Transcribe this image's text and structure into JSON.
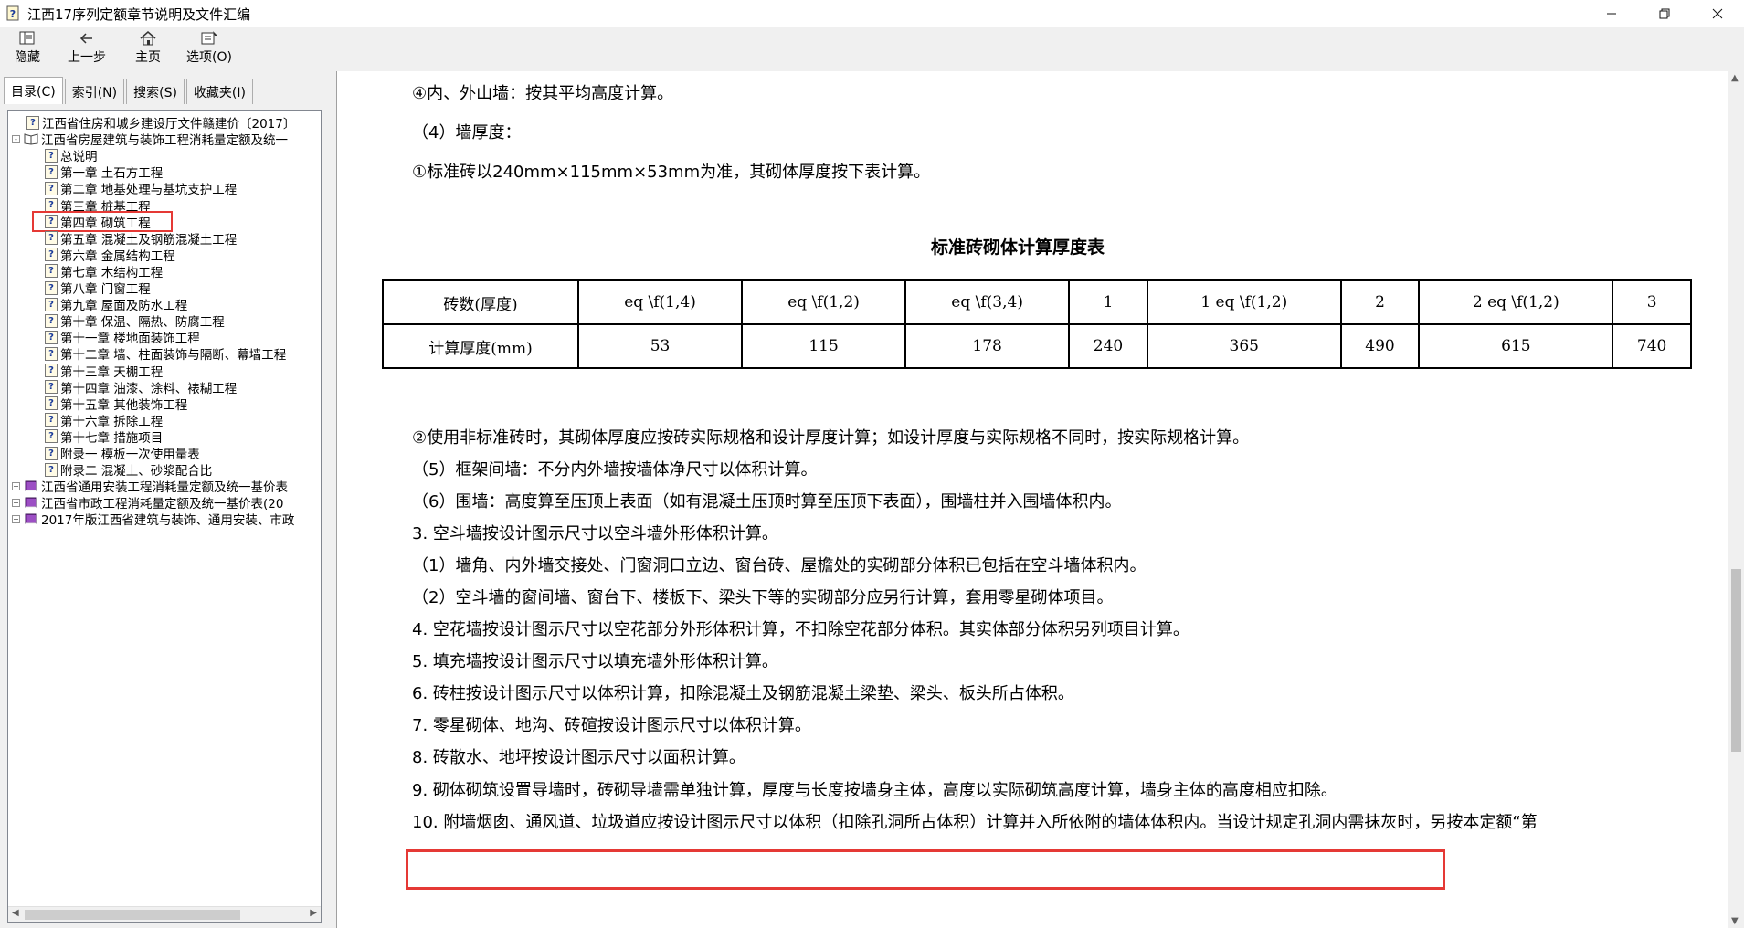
{
  "window": {
    "title": "江西17序列定额章节说明及文件汇编",
    "controls": [
      "minimize",
      "maximize",
      "close"
    ]
  },
  "toolbar": {
    "buttons": [
      {
        "label": "隐藏",
        "icon": "hide-icon"
      },
      {
        "label": "上一步",
        "icon": "back-arrow-icon"
      },
      {
        "label": "主页",
        "icon": "home-icon"
      },
      {
        "label": "选项(O)",
        "icon": "options-icon"
      }
    ]
  },
  "tabs": [
    {
      "label": "目录(C)",
      "active": true
    },
    {
      "label": "索引(N)",
      "active": false
    },
    {
      "label": "搜索(S)",
      "active": false
    },
    {
      "label": "收藏夹(I)",
      "active": false
    }
  ],
  "tree": [
    {
      "label": "江西省住房和城乡建设厅文件赣建价〔2017〕",
      "level": 1,
      "icon": "help-page-icon",
      "expander": ""
    },
    {
      "label": "江西省房屋建筑与装饰工程消耗量定额及统一",
      "level": 0,
      "icon": "open-book-icon",
      "expander": "-"
    },
    {
      "label": "总说明",
      "level": 2,
      "icon": "help-page-icon",
      "expander": ""
    },
    {
      "label": "第一章  土石方工程",
      "level": 2,
      "icon": "help-page-icon",
      "expander": ""
    },
    {
      "label": "第二章  地基处理与基坑支护工程",
      "level": 2,
      "icon": "help-page-icon",
      "expander": ""
    },
    {
      "label": "第三章  桩基工程",
      "level": 2,
      "icon": "help-page-icon",
      "expander": ""
    },
    {
      "label": "第四章  砌筑工程",
      "level": 2,
      "icon": "help-page-icon",
      "expander": "",
      "selected": true
    },
    {
      "label": "第五章  混凝土及钢筋混凝土工程",
      "level": 2,
      "icon": "help-page-icon",
      "expander": ""
    },
    {
      "label": "第六章  金属结构工程",
      "level": 2,
      "icon": "help-page-icon",
      "expander": ""
    },
    {
      "label": "第七章  木结构工程",
      "level": 2,
      "icon": "help-page-icon",
      "expander": ""
    },
    {
      "label": "第八章  门窗工程",
      "level": 2,
      "icon": "help-page-icon",
      "expander": ""
    },
    {
      "label": "第九章  屋面及防水工程",
      "level": 2,
      "icon": "help-page-icon",
      "expander": ""
    },
    {
      "label": "第十章  保温、隔热、防腐工程",
      "level": 2,
      "icon": "help-page-icon",
      "expander": ""
    },
    {
      "label": "第十一章  楼地面装饰工程",
      "level": 2,
      "icon": "help-page-icon",
      "expander": ""
    },
    {
      "label": "第十二章  墙、柱面装饰与隔断、幕墙工程",
      "level": 2,
      "icon": "help-page-icon",
      "expander": ""
    },
    {
      "label": "第十三章  天棚工程",
      "level": 2,
      "icon": "help-page-icon",
      "expander": ""
    },
    {
      "label": "第十四章  油漆、涂料、裱糊工程",
      "level": 2,
      "icon": "help-page-icon",
      "expander": ""
    },
    {
      "label": "第十五章  其他装饰工程",
      "level": 2,
      "icon": "help-page-icon",
      "expander": ""
    },
    {
      "label": "第十六章  拆除工程",
      "level": 2,
      "icon": "help-page-icon",
      "expander": ""
    },
    {
      "label": "第十七章  措施项目",
      "level": 2,
      "icon": "help-page-icon",
      "expander": ""
    },
    {
      "label": "附录一  模板一次使用量表",
      "level": 2,
      "icon": "help-page-icon",
      "expander": ""
    },
    {
      "label": "附录二  混凝土、砂浆配合比",
      "level": 2,
      "icon": "help-page-icon",
      "expander": ""
    },
    {
      "label": "江西省通用安装工程消耗量定额及统一基价表",
      "level": 0,
      "icon": "closed-book-icon",
      "expander": "+"
    },
    {
      "label": "江西省市政工程消耗量定额及统一基价表(20",
      "level": 0,
      "icon": "closed-book-icon",
      "expander": "+"
    },
    {
      "label": "2017年版江西省建筑与装饰、通用安装、市政",
      "level": 0,
      "icon": "closed-book-icon",
      "expander": "+"
    }
  ],
  "content": {
    "lines_top": [
      "④内、外山墙：按其平均高度计算。",
      "（4）墙厚度：",
      "①标准砖以240mm×115mm×53mm为准，其砌体厚度按下表计算。"
    ],
    "table": {
      "title": "标准砖砌体计算厚度表",
      "header": [
        "砖数(厚度)",
        "eq \\f(1,4)",
        "eq \\f(1,2)",
        "eq \\f(3,4)",
        "1",
        "1 eq \\f(1,2)",
        "2",
        "2 eq \\f(1,2)",
        "3"
      ],
      "row": [
        "计算厚度(mm)",
        "53",
        "115",
        "178",
        "240",
        "365",
        "490",
        "615",
        "740"
      ]
    },
    "lines_bottom": [
      "②使用非标准砖时，其砌体厚度应按砖实际规格和设计厚度计算；如设计厚度与实际规格不同时，按实际规格计算。",
      "（5）框架间墙：不分内外墙按墙体净尺寸以体积计算。",
      "（6）围墙：高度算至压顶上表面（如有混凝土压顶时算至压顶下表面），围墙柱并入围墙体积内。",
      "3. 空斗墙按设计图示尺寸以空斗墙外形体积计算。",
      "（1）墙角、内外墙交接处、门窗洞口立边、窗台砖、屋檐处的实砌部分体积已包括在空斗墙体积内。",
      "（2）空斗墙的窗间墙、窗台下、楼板下、梁头下等的实砌部分应另行计算，套用零星砌体项目。",
      "4. 空花墙按设计图示尺寸以空花部分外形体积计算，不扣除空花部分体积。其实体部分体积另列项目计算。",
      "5. 填充墙按设计图示尺寸以填充墙外形体积计算。",
      "6. 砖柱按设计图示尺寸以体积计算，扣除混凝土及钢筋混凝土梁垫、梁头、板头所占体积。",
      "7. 零星砌体、地沟、砖碹按设计图示尺寸以体积计算。",
      "8. 砖散水、地坪按设计图示尺寸以面积计算。",
      "9. 砌体砌筑设置导墙时，砖砌导墙需单独计算，厚度与长度按墙身主体，高度以实际砌筑高度计算，墙身主体的高度相应扣除。",
      "10. 附墙烟囱、通风道、垃圾道应按设计图示尺寸以体积（扣除孔洞所占体积）计算并入所依附的墙体体积内。当设计规定孔洞内需抹灰时，另按本定额“第"
    ]
  },
  "colors": {
    "highlight": "#e53935",
    "border": "#000000"
  }
}
